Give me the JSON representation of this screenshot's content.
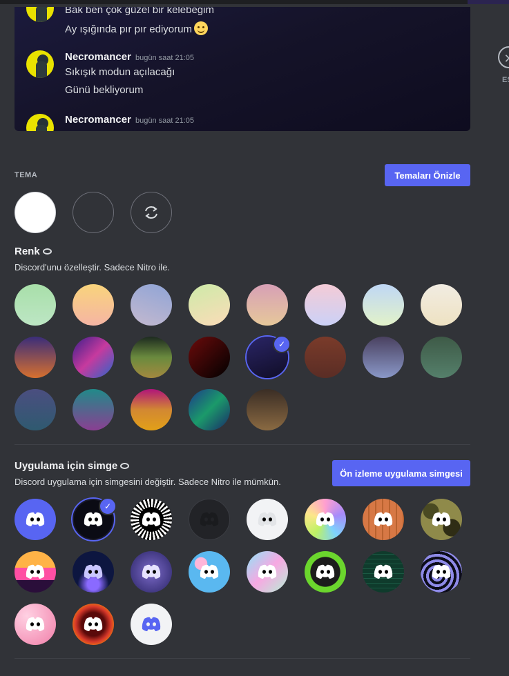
{
  "chat_preview": {
    "lines_top": [
      "Bak ben çok güzel bir kelebeğim",
      "Ay ışığında pır pır ediyorum"
    ],
    "messages": [
      {
        "author": "Necromancer",
        "time": "bugün saat 21:05",
        "lines": [
          "Sıkışık modun açılacağı",
          "Günü bekliyorum"
        ]
      },
      {
        "author": "Necromancer",
        "time": "bugün saat 21:05",
        "lines": []
      }
    ]
  },
  "close": {
    "label": "ES",
    "icon": "close-icon"
  },
  "theme": {
    "section_label": "TEMA",
    "preview_button": "Temaları Önizle",
    "options": [
      "light",
      "dark",
      "sync"
    ]
  },
  "color": {
    "title": "Renk",
    "description": "Discord'unu özelleştir. Sadece Nitro ile.",
    "selected_index": 12
  },
  "app_icon": {
    "title": "Uygulama için simge",
    "description": "Discord uygulama için simgesini değiştir. Sadece Nitro ile mümkün.",
    "preview_button": "Ön izleme uygulama simgesi",
    "selected_index": 1
  },
  "colors": {
    "accent": "#5865f2",
    "background": "#313338"
  }
}
